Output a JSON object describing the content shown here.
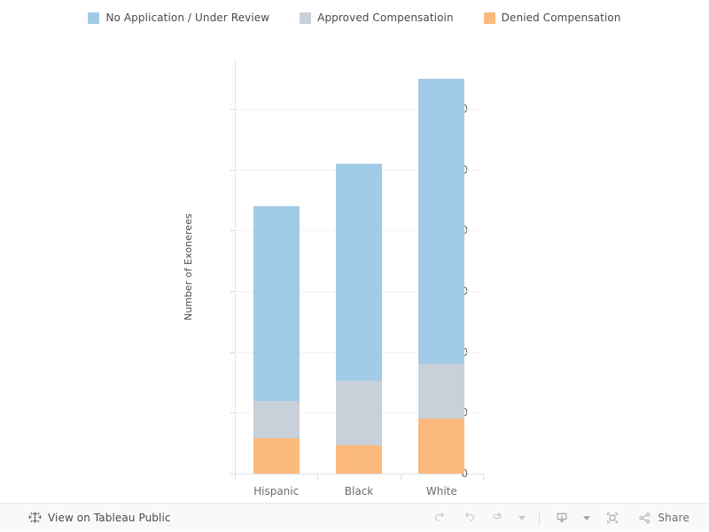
{
  "legend": {
    "items": [
      {
        "label": "No Application / Under Review",
        "color": "#a1cbe8",
        "icon": "legend-swatch"
      },
      {
        "label": "Approved Compensatioin",
        "color": "#c8d0da",
        "icon": "legend-swatch"
      },
      {
        "label": "Denied Compensation",
        "color": "#fcb97d",
        "icon": "legend-swatch"
      }
    ]
  },
  "chart_data": {
    "type": "bar",
    "stacked": true,
    "title": "",
    "xlabel": "",
    "ylabel": "Number of Exonerees",
    "categories": [
      "Hispanic",
      "Black",
      "White"
    ],
    "ylim": [
      0,
      68
    ],
    "yticks": [
      0,
      10,
      20,
      30,
      40,
      50,
      60
    ],
    "ytick_labels": [
      "0",
      "10",
      "20",
      "30",
      "40",
      "50",
      "60"
    ],
    "grid": true,
    "legend_position": "top",
    "series": [
      {
        "name": "Denied Compensation",
        "color": "#fcb97d",
        "values": [
          5.8,
          4.6,
          9
        ]
      },
      {
        "name": "Approved Compensatioin",
        "color": "#c8d0da",
        "values": [
          6.2,
          10.7,
          9
        ]
      },
      {
        "name": "No Application / Under Review",
        "color": "#a1cbe8",
        "values": [
          32,
          35.7,
          47
        ]
      }
    ],
    "totals": [
      44,
      51,
      65
    ]
  },
  "toolbar": {
    "tableau_link_label": "View on Tableau Public",
    "tableau_icon": "tableau-logo-icon",
    "buttons": [
      {
        "name": "undo",
        "icon": "undo-icon",
        "label": "Undo"
      },
      {
        "name": "redo",
        "icon": "redo-icon",
        "label": "Redo"
      },
      {
        "name": "revert",
        "icon": "revert-icon",
        "label": "Revert"
      },
      {
        "name": "revert-menu",
        "icon": "caret-down-icon",
        "label": ""
      },
      {
        "name": "download",
        "icon": "download-icon",
        "label": "Download"
      },
      {
        "name": "download-menu",
        "icon": "caret-down-icon",
        "label": ""
      },
      {
        "name": "fullscreen",
        "icon": "fullscreen-icon",
        "label": "Full Screen"
      }
    ],
    "share_label": "Share",
    "share_icon": "share-nodes-icon"
  },
  "colors": {
    "blue": "#a1cbe8",
    "grey": "#c8d0da",
    "orange": "#fcb97d",
    "axis_text": "#6b6b6b",
    "gridline": "#f2f2f2",
    "toolbar_bg": "#f9f9f9"
  }
}
